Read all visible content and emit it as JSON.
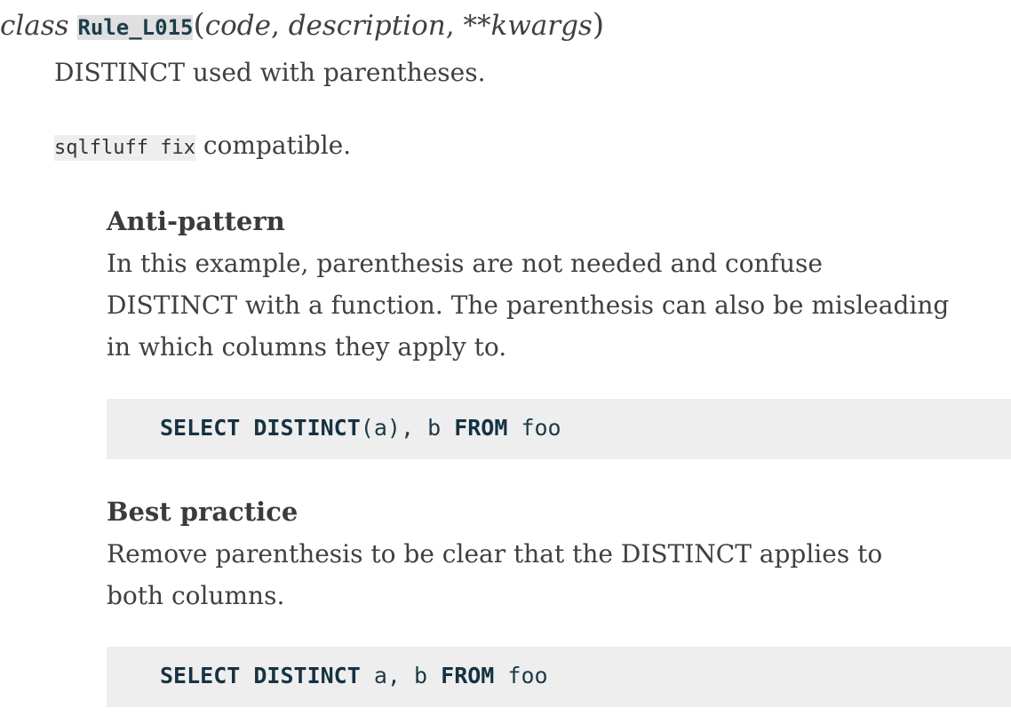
{
  "signature": {
    "keyword": "class",
    "name": "Rule_L015",
    "open_paren": "(",
    "params": [
      "code",
      "description",
      "**kwargs"
    ],
    "separator": ", ",
    "close_paren": ")"
  },
  "description": "DISTINCT used with parentheses.",
  "compat": {
    "code": "sqlfluff fix",
    "text": " compatible."
  },
  "anti_pattern": {
    "heading": "Anti-pattern",
    "lines": [
      "In this example, parenthesis are not needed and confuse",
      "DISTINCT with a function. The parenthesis can also be misleading",
      "in which columns they apply to."
    ],
    "code_tokens": [
      {
        "t": "SELECT",
        "k": true
      },
      {
        "t": " ",
        "k": false
      },
      {
        "t": "DISTINCT",
        "k": true
      },
      {
        "t": "(a), ",
        "k": false
      },
      {
        "t": "b",
        "k": false
      },
      {
        "t": " ",
        "k": false
      },
      {
        "t": "FROM",
        "k": true
      },
      {
        "t": " foo",
        "k": false
      }
    ]
  },
  "best_practice": {
    "heading": "Best practice",
    "lines": [
      "Remove parenthesis to be clear that the DISTINCT applies to",
      "both columns."
    ],
    "code_tokens": [
      {
        "t": "SELECT",
        "k": true
      },
      {
        "t": " ",
        "k": false
      },
      {
        "t": "DISTINCT",
        "k": true
      },
      {
        "t": " a, ",
        "k": false
      },
      {
        "t": "b",
        "k": false
      },
      {
        "t": " ",
        "k": false
      },
      {
        "t": "FROM",
        "k": true
      },
      {
        "t": " foo",
        "k": false
      }
    ]
  }
}
